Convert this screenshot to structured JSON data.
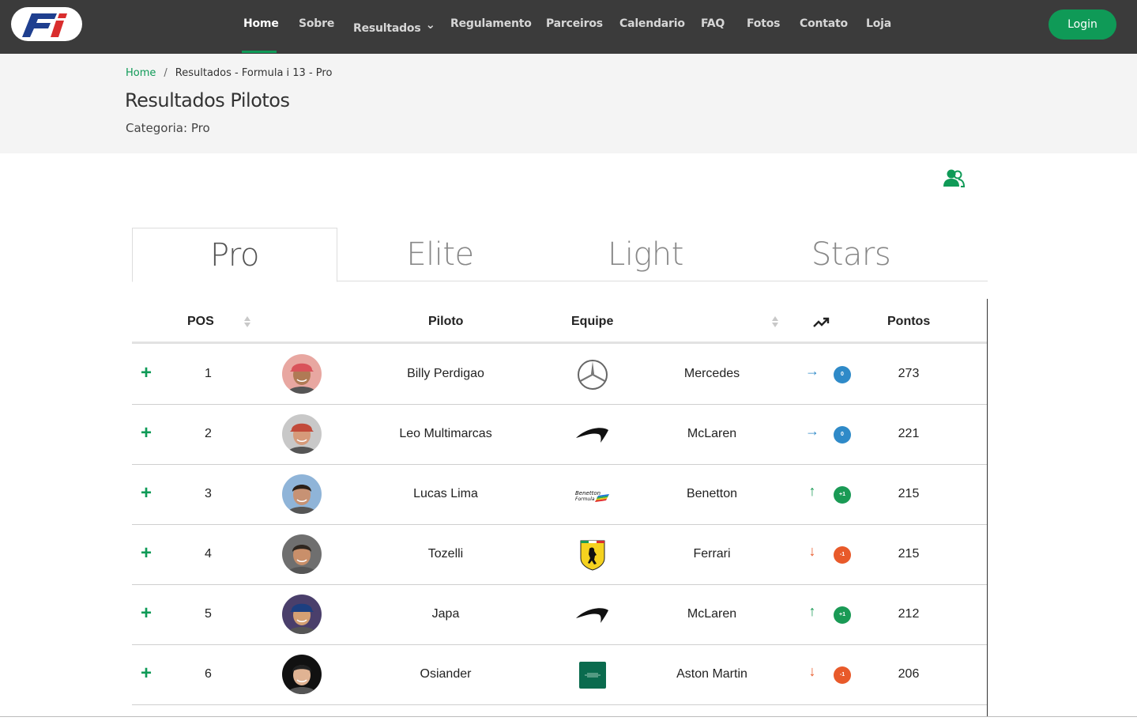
{
  "nav": {
    "items": [
      {
        "label": "Home",
        "name": "nav-home",
        "active": true
      },
      {
        "label": "Sobre",
        "name": "nav-sobre"
      },
      {
        "label": "Resultados",
        "name": "nav-resultados",
        "dropdown": true
      },
      {
        "label": "Regulamento",
        "name": "nav-regulamento"
      },
      {
        "label": "Parceiros",
        "name": "nav-parceiros"
      },
      {
        "label": "Calendario",
        "name": "nav-calendario"
      },
      {
        "label": "FAQ",
        "name": "nav-faq"
      },
      {
        "label": "Fotos",
        "name": "nav-fotos"
      },
      {
        "label": "Contato",
        "name": "nav-contato"
      },
      {
        "label": "Loja",
        "name": "nav-loja"
      }
    ],
    "login_label": "Login"
  },
  "breadcrumb": {
    "home": "Home",
    "separator": "/",
    "current": "Resultados - Formula i 13 - Pro"
  },
  "page": {
    "title": "Resultados Pilotos",
    "subtitle": "Categoria: Pro"
  },
  "tabs": [
    {
      "label": "Pro",
      "active": true
    },
    {
      "label": "Elite"
    },
    {
      "label": "Light"
    },
    {
      "label": "Stars"
    }
  ],
  "table": {
    "headers": {
      "pos": "POS",
      "pilot": "Piloto",
      "team": "Equipe",
      "trend_icon": "trending-up-icon",
      "points": "Pontos"
    },
    "rows": [
      {
        "pos": "1",
        "pilot": "Billy Perdigao",
        "team": "Mercedes",
        "team_logo": "mercedes-logo",
        "trend": "same",
        "change": "0",
        "points": "273"
      },
      {
        "pos": "2",
        "pilot": "Leo Multimarcas",
        "team": "McLaren",
        "team_logo": "mclaren-logo",
        "trend": "same",
        "change": "0",
        "points": "221"
      },
      {
        "pos": "3",
        "pilot": "Lucas Lima",
        "team": "Benetton",
        "team_logo": "benetton-logo",
        "trend": "up",
        "change": "+1",
        "points": "215"
      },
      {
        "pos": "4",
        "pilot": "Tozelli",
        "team": "Ferrari",
        "team_logo": "ferrari-logo",
        "trend": "down",
        "change": "-1",
        "points": "215"
      },
      {
        "pos": "5",
        "pilot": "Japa",
        "team": "McLaren",
        "team_logo": "mclaren-logo",
        "trend": "up",
        "change": "+1",
        "points": "212"
      },
      {
        "pos": "6",
        "pilot": "Osiander",
        "team": "Aston Martin",
        "team_logo": "aston-martin-logo",
        "trend": "down",
        "change": "-1",
        "points": "206"
      }
    ]
  },
  "colors": {
    "accent": "#0f9a57",
    "navbar": "#3b3b3b",
    "same": "#2f8ac8",
    "up": "#1a9a55",
    "down": "#e85a2a"
  }
}
